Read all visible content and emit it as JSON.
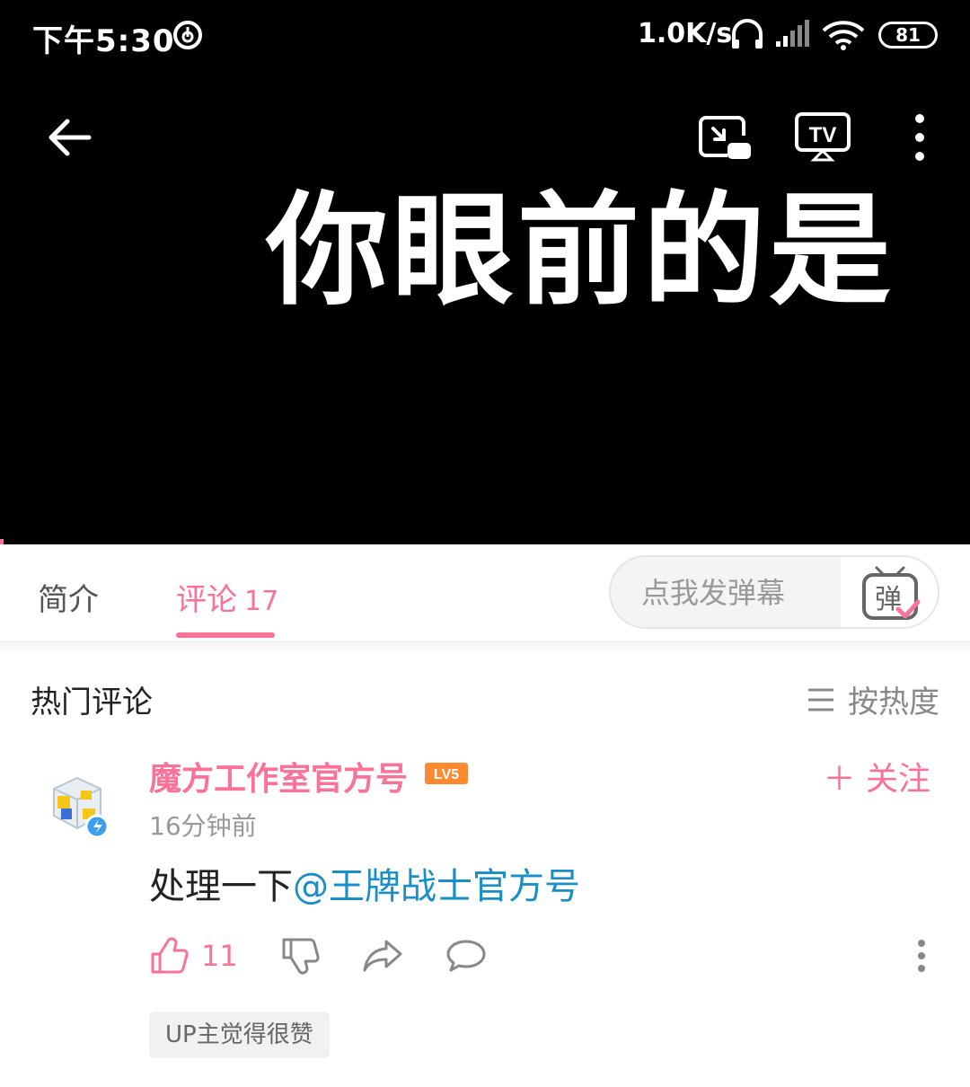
{
  "status_bar": {
    "time": "下午5:30",
    "speed": "1.0K/s",
    "battery": "81"
  },
  "video": {
    "subtitle": "你眼前的是",
    "icons": [
      "back-arrow-icon",
      "picture-in-picture-icon",
      "tv-cast-icon",
      "more-vertical-icon"
    ]
  },
  "tabs": {
    "intro": "简介",
    "comments": "评论",
    "comments_count": "17",
    "danmaku_placeholder": "点我发弹幕",
    "danmaku_toggle_char": "弹"
  },
  "comments_section": {
    "title": "热门评论",
    "sort_label": "按热度",
    "items": [
      {
        "username": "魔方工作室官方号",
        "level": "LV5",
        "follow_label": "＋ 关注",
        "time": "16分钟前",
        "text_prefix": "处理一下",
        "mention": "@王牌战士官方号",
        "likes": "11",
        "up_badge": "UP主觉得很赞"
      }
    ]
  },
  "colors": {
    "accent": "#fb7299",
    "mention": "#1a8fc7",
    "video_bg": "#000000"
  }
}
